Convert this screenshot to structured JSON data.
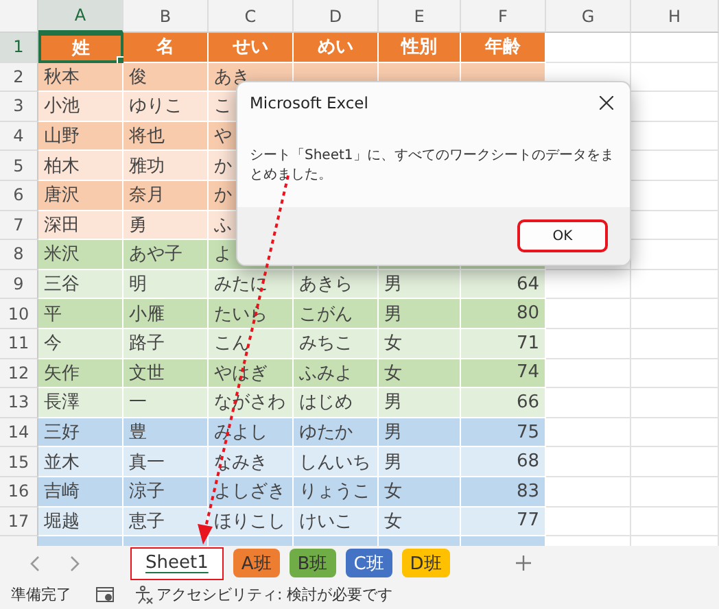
{
  "columns": [
    {
      "label": "A",
      "selected": true
    },
    {
      "label": "B",
      "selected": false
    },
    {
      "label": "C",
      "selected": false
    },
    {
      "label": "D",
      "selected": false
    },
    {
      "label": "E",
      "selected": false
    },
    {
      "label": "F",
      "selected": false
    },
    {
      "label": "G",
      "selected": false
    },
    {
      "label": "H",
      "selected": false
    }
  ],
  "rows": [
    {
      "number": "1",
      "kind": "header",
      "selected": true,
      "color": "#ed7d31",
      "cells": [
        "姓",
        "名",
        "せい",
        "めい",
        "性別",
        "年齢"
      ]
    },
    {
      "number": "2",
      "kind": "data",
      "selected": false,
      "color": "#f8cbad",
      "cells": [
        "秋本",
        "俊",
        "あき",
        null,
        null,
        null
      ]
    },
    {
      "number": "3",
      "kind": "data",
      "selected": false,
      "color": "#fce4d6",
      "cells": [
        "小池",
        "ゆりこ",
        "こ",
        null,
        null,
        null
      ]
    },
    {
      "number": "4",
      "kind": "data",
      "selected": false,
      "color": "#f8cbad",
      "cells": [
        "山野",
        "将也",
        "や",
        null,
        null,
        null
      ]
    },
    {
      "number": "5",
      "kind": "data",
      "selected": false,
      "color": "#fce4d6",
      "cells": [
        "柏木",
        "雅功",
        "か",
        null,
        null,
        null
      ]
    },
    {
      "number": "6",
      "kind": "data",
      "selected": false,
      "color": "#f8cbad",
      "cells": [
        "唐沢",
        "奈月",
        "か",
        null,
        null,
        null
      ]
    },
    {
      "number": "7",
      "kind": "data",
      "selected": false,
      "color": "#fce4d6",
      "cells": [
        "深田",
        "勇",
        "ふ",
        null,
        null,
        null
      ]
    },
    {
      "number": "8",
      "kind": "data",
      "selected": false,
      "color": "#c6e0b4",
      "cells": [
        "米沢",
        "あや子",
        "よ",
        null,
        null,
        null
      ]
    },
    {
      "number": "9",
      "kind": "data",
      "selected": false,
      "color": "#e2efda",
      "cells": [
        "三谷",
        "明",
        "みたに",
        "あきら",
        "男",
        "64"
      ]
    },
    {
      "number": "10",
      "kind": "data",
      "selected": false,
      "color": "#c6e0b4",
      "cells": [
        "平",
        "小雁",
        "たいら",
        "こがん",
        "男",
        "80"
      ]
    },
    {
      "number": "11",
      "kind": "data",
      "selected": false,
      "color": "#e2efda",
      "cells": [
        "今",
        "路子",
        "こん",
        "みちこ",
        "女",
        "71"
      ]
    },
    {
      "number": "12",
      "kind": "data",
      "selected": false,
      "color": "#c6e0b4",
      "cells": [
        "矢作",
        "文世",
        "やはぎ",
        "ふみよ",
        "女",
        "74"
      ]
    },
    {
      "number": "13",
      "kind": "data",
      "selected": false,
      "color": "#e2efda",
      "cells": [
        "長澤",
        "一",
        "ながさわ",
        "はじめ",
        "男",
        "66"
      ]
    },
    {
      "number": "14",
      "kind": "data",
      "selected": false,
      "color": "#bdd7ee",
      "cells": [
        "三好",
        "豊",
        "みよし",
        "ゆたか",
        "男",
        "75"
      ]
    },
    {
      "number": "15",
      "kind": "data",
      "selected": false,
      "color": "#ddebf7",
      "cells": [
        "並木",
        "真一",
        "なみき",
        "しんいち",
        "男",
        "68"
      ]
    },
    {
      "number": "16",
      "kind": "data",
      "selected": false,
      "color": "#bdd7ee",
      "cells": [
        "吉崎",
        "涼子",
        "よしざき",
        "りょうこ",
        "女",
        "83"
      ]
    },
    {
      "number": "17",
      "kind": "data",
      "selected": false,
      "color": "#ddebf7",
      "cells": [
        "堀越",
        "恵子",
        "ほりこし",
        "けいこ",
        "女",
        "77"
      ]
    },
    {
      "kind": "data",
      "selected": false,
      "color": "#bdd7ee",
      "cells": [
        null,
        null,
        null,
        null,
        null,
        null
      ]
    }
  ],
  "dialog": {
    "title": "Microsoft Excel",
    "message": "シート「Sheet1」に、すべてのワークシートのデータをまとめました。",
    "button": "OK"
  },
  "sheet_tabs": [
    {
      "label": "Sheet1",
      "color": "#ffffff",
      "selected": true
    },
    {
      "label": "A班",
      "color": "#ed7d31",
      "selected": false
    },
    {
      "label": "B班",
      "color": "#70ad47",
      "selected": false
    },
    {
      "label": "C班",
      "color": "#4472c4",
      "selected": false
    },
    {
      "label": "D班",
      "color": "#ffc000",
      "selected": false
    }
  ],
  "status_bar": {
    "ready": "準備完了",
    "accessibility": "アクセシビリティ: 検討が必要です"
  }
}
